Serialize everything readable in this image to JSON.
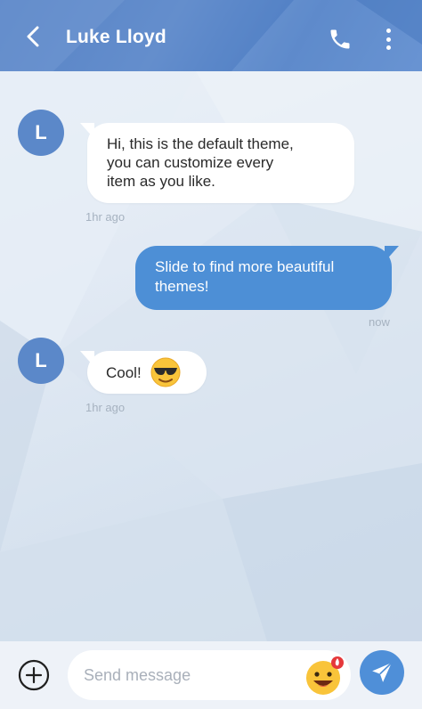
{
  "header": {
    "contact_name": "Luke Lloyd",
    "back_icon": "chevron-left-icon",
    "call_icon": "phone-icon",
    "more_icon": "more-vertical-icon"
  },
  "colors": {
    "header": "#5b86c7",
    "accent": "#4d8fd6",
    "avatar": "#5b88c9",
    "timestamp": "#a6b2c0"
  },
  "messages": [
    {
      "direction": "incoming",
      "avatar_initial": "L",
      "lines": [
        "Hi, this is the default theme,",
        "you can customize every",
        "item as you like."
      ],
      "time": "1hr ago"
    },
    {
      "direction": "outgoing",
      "lines": [
        "Slide to find more beautiful",
        "themes!"
      ],
      "time": "now"
    },
    {
      "direction": "incoming",
      "avatar_initial": "L",
      "text": "Cool!",
      "emoji": "smiling-face-with-sunglasses",
      "time": "1hr ago"
    }
  ],
  "composer": {
    "add_icon": "plus-circle-icon",
    "placeholder": "Send message",
    "value": "",
    "emoji_icon": "emoji-hot-icon",
    "send_icon": "send-icon"
  }
}
